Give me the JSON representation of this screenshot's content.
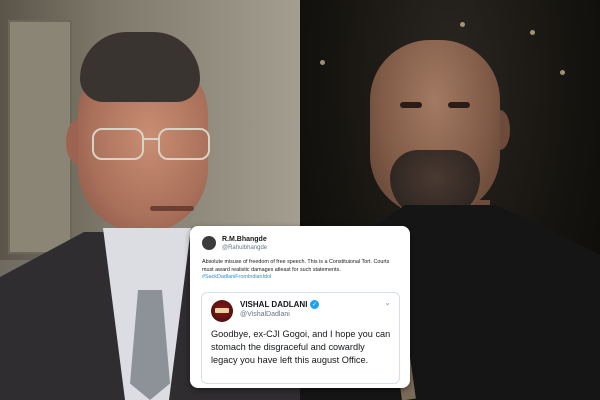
{
  "tweet": {
    "author_name": "R.M.Bhangde",
    "author_handle": "@Rahulbhangde",
    "body": "Absolute misuse of freedom of free speech. This is a Constituional Tort. Courts must award realistic damages atleast for such statements.",
    "hashtag": "#SackDadlaniFromIndianIdol"
  },
  "quoted_tweet": {
    "author_name": "VISHAL DADLANI",
    "author_handle": "@VishalDadlani",
    "verified_icon": "✓",
    "menu_icon": "⌄",
    "body": "Goodbye, ex-CJI Gogoi, and I hope you can stomach the disgraceful and cowardly legacy you have left this august Office."
  },
  "colors": {
    "link": "#1b95e0",
    "verified": "#1da1f2",
    "text_primary": "#14171a",
    "text_secondary": "#657786"
  }
}
